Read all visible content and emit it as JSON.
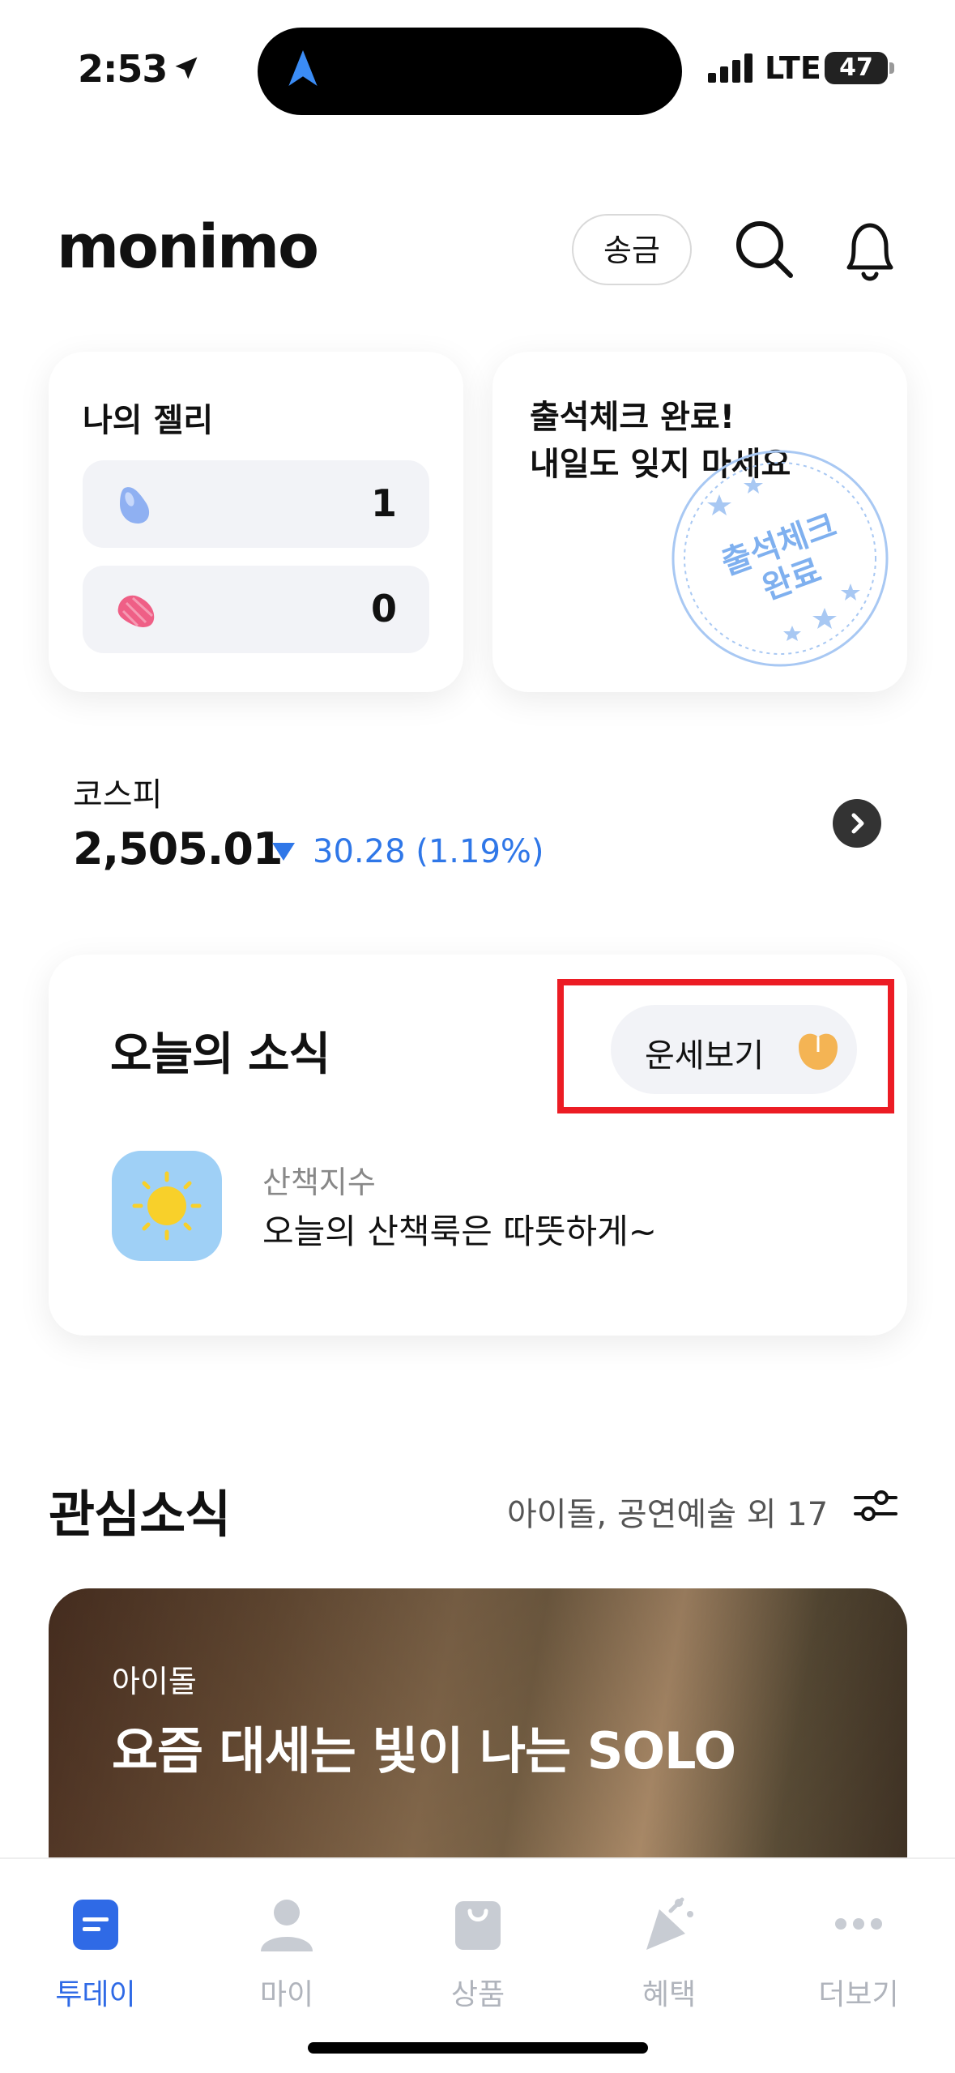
{
  "status_bar": {
    "time": "2:53",
    "network": "LTE",
    "battery": "47"
  },
  "header": {
    "logo": "monimo",
    "transfer_label": "송금"
  },
  "jelly": {
    "title": "나의 젤리",
    "rows": [
      {
        "icon": "blue-jelly-icon",
        "value": "1"
      },
      {
        "icon": "pink-jelly-icon",
        "value": "0"
      }
    ]
  },
  "attendance": {
    "line1": "출석체크 완료!",
    "line2": "내일도 잊지 마세요",
    "stamp_text_1": "출석체크",
    "stamp_text_2": "완료"
  },
  "kospi": {
    "label": "코스피",
    "value": "2,505.01",
    "change": "30.28 (1.19%)"
  },
  "today_news": {
    "title": "오늘의 소식",
    "fortune_label": "운세보기",
    "item": {
      "sub": "산책지수",
      "text": "오늘의 산책룩은 따뜻하게~"
    }
  },
  "interest": {
    "title": "관심소식",
    "tags": "아이돌, 공연예술 외 17",
    "hero": {
      "tag": "아이돌",
      "title": "요즘 대세는 빛이 나는 SOLO"
    }
  },
  "tabs": [
    {
      "label": "투데이",
      "icon": "today-icon",
      "active": true
    },
    {
      "label": "마이",
      "icon": "person-icon",
      "active": false
    },
    {
      "label": "상품",
      "icon": "shopping-bag-icon",
      "active": false
    },
    {
      "label": "혜택",
      "icon": "party-popper-icon",
      "active": false
    },
    {
      "label": "더보기",
      "icon": "more-dots-icon",
      "active": false
    }
  ],
  "colors": {
    "accent": "#2f6ae6",
    "down": "#2f77e8",
    "highlight": "#ec1c24"
  }
}
